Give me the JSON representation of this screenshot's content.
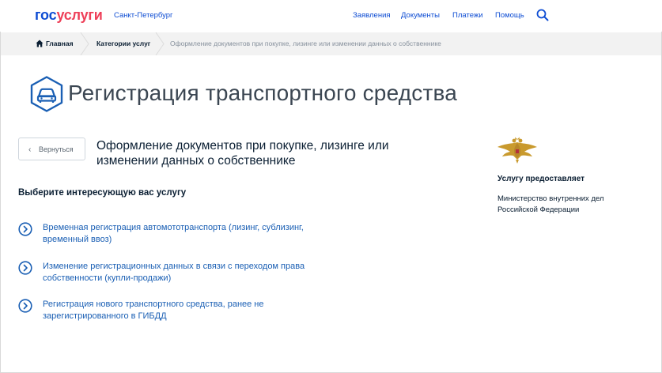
{
  "header": {
    "logo_part1": "гос",
    "logo_part2": "услуги",
    "region": "Санкт-Петербург",
    "nav": [
      "Заявления",
      "Документы",
      "Платежи",
      "Помощь"
    ],
    "search_icon": "search-icon"
  },
  "breadcrumbs": {
    "home": "Главная",
    "category": "Категории услуг",
    "current": "Оформление документов при покупке, лизинге или изменении данных о собственнике"
  },
  "main": {
    "title": "Регистрация транспортного средства",
    "back_label": "Вернуться",
    "subtitle": "Оформление документов при покупке, лизинге или изменении данных о собственнике",
    "section_heading": "Выберите интересующую вас услугу",
    "options": [
      "Временная регистрация автомототранспорта (лизинг, сублизинг, временный ввоз)",
      "Изменение регистрационных данных в связи с переходом права собственности (купли-продажи)",
      "Регистрация нового транспортного средства, ранее не зарегистрированного в ГИБДД"
    ]
  },
  "provider": {
    "label": "Услугу предоставляет",
    "name": "Министерство внутренних дел Российской Федерации"
  },
  "colors": {
    "brand_blue": "#0d4cd3",
    "brand_red": "#ee3f58",
    "link": "#1a5fb4",
    "crumb_bg": "#f2f2f2"
  }
}
